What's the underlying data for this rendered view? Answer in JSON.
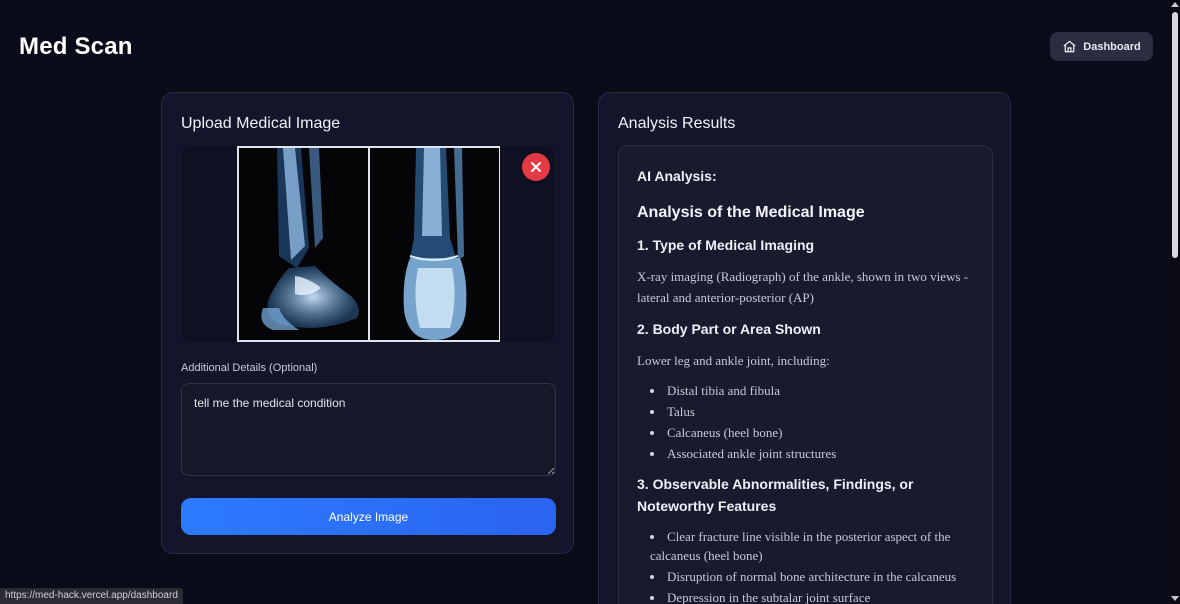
{
  "app": {
    "title": "Med Scan"
  },
  "header": {
    "dashboard_label": "Dashboard"
  },
  "upload": {
    "title": "Upload Medical Image",
    "details_label": "Additional Details (Optional)",
    "details_value": "tell me the medical condition",
    "analyze_label": "Analyze Image"
  },
  "results": {
    "title": "Analysis Results",
    "ai_label": "AI Analysis:",
    "heading": "Analysis of the Medical Image",
    "s1": {
      "title": "1. Type of Medical Imaging",
      "text": "X-ray imaging (Radiograph) of the ankle, shown in two views - lateral and anterior-posterior (AP)"
    },
    "s2": {
      "title": "2. Body Part or Area Shown",
      "text": "Lower leg and ankle joint, including:",
      "items": [
        "Distal tibia and fibula",
        "Talus",
        "Calcaneus (heel bone)",
        "Associated ankle joint structures"
      ]
    },
    "s3": {
      "title": "3. Observable Abnormalities, Findings, or Noteworthy Features",
      "items": [
        "Clear fracture line visible in the posterior aspect of the calcaneus (heel bone)",
        "Disruption of normal bone architecture in the calcaneus",
        "Depression in the subtalar joint surface"
      ]
    }
  },
  "status_bar": {
    "url": "https://med-hack.vercel.app/dashboard"
  },
  "colors": {
    "background": "#0b0c1a",
    "card": "#13152a",
    "accent": "#2d7bff",
    "danger": "#e53a44"
  },
  "icons": {
    "dashboard": "home-icon",
    "remove": "close-icon"
  }
}
